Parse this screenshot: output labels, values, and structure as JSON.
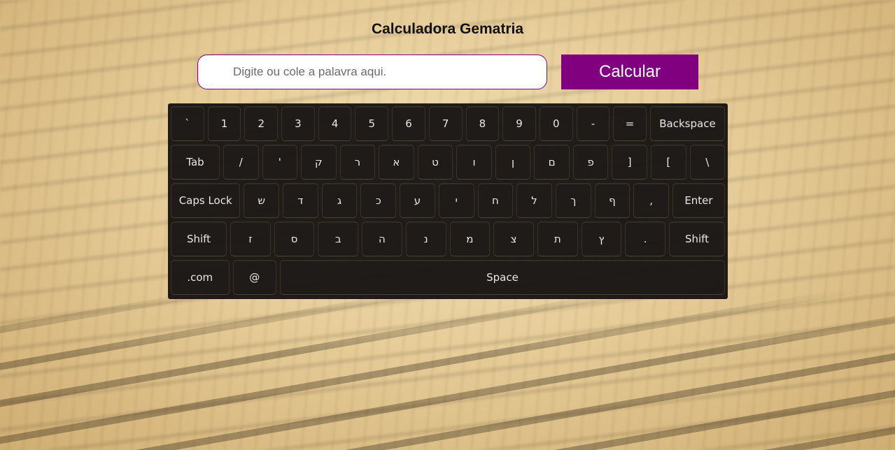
{
  "page": {
    "title": "Calculadora Gematria",
    "search": {
      "value": "",
      "placeholder": "Digite ou cole a palavra aqui."
    },
    "calc_button": "Calcular",
    "colors": {
      "accent": "#800080",
      "keyboard_bg": "#0f0c0a"
    }
  },
  "keyboard": {
    "rows": [
      {
        "keys": [
          {
            "label": "`",
            "grow": 1
          },
          {
            "label": "1",
            "grow": 1
          },
          {
            "label": "2",
            "grow": 1
          },
          {
            "label": "3",
            "grow": 1
          },
          {
            "label": "4",
            "grow": 1
          },
          {
            "label": "5",
            "grow": 1
          },
          {
            "label": "6",
            "grow": 1
          },
          {
            "label": "7",
            "grow": 1
          },
          {
            "label": "8",
            "grow": 1
          },
          {
            "label": "9",
            "grow": 1
          },
          {
            "label": "0",
            "grow": 1
          },
          {
            "label": "-",
            "grow": 1
          },
          {
            "label": "=",
            "grow": 1
          },
          {
            "label": "Backspace",
            "grow": 2.3
          }
        ]
      },
      {
        "keys": [
          {
            "label": "Tab",
            "grow": 1.4
          },
          {
            "label": "/",
            "grow": 1
          },
          {
            "label": "'",
            "grow": 1
          },
          {
            "label": "ק",
            "grow": 1
          },
          {
            "label": "ר",
            "grow": 1
          },
          {
            "label": "א",
            "grow": 1
          },
          {
            "label": "ט",
            "grow": 1
          },
          {
            "label": "ו",
            "grow": 1
          },
          {
            "label": "ן",
            "grow": 1
          },
          {
            "label": "ם",
            "grow": 1
          },
          {
            "label": "פ",
            "grow": 1
          },
          {
            "label": "]",
            "grow": 1
          },
          {
            "label": "[",
            "grow": 1
          },
          {
            "label": "\\",
            "grow": 1
          }
        ]
      },
      {
        "keys": [
          {
            "label": "Caps Lock",
            "grow": 2
          },
          {
            "label": "ש",
            "grow": 1
          },
          {
            "label": "ד",
            "grow": 1
          },
          {
            "label": "ג",
            "grow": 1
          },
          {
            "label": "כ",
            "grow": 1
          },
          {
            "label": "ע",
            "grow": 1
          },
          {
            "label": "י",
            "grow": 1
          },
          {
            "label": "ח",
            "grow": 1
          },
          {
            "label": "ל",
            "grow": 1
          },
          {
            "label": "ך",
            "grow": 1
          },
          {
            "label": "ף",
            "grow": 1
          },
          {
            "label": ",",
            "grow": 1
          },
          {
            "label": "Enter",
            "grow": 1.5
          }
        ]
      },
      {
        "keys": [
          {
            "label": "Shift",
            "grow": 1.4
          },
          {
            "label": "ז",
            "grow": 1
          },
          {
            "label": "ס",
            "grow": 1
          },
          {
            "label": "ב",
            "grow": 1
          },
          {
            "label": "ה",
            "grow": 1
          },
          {
            "label": "נ",
            "grow": 1
          },
          {
            "label": "מ",
            "grow": 1
          },
          {
            "label": "צ",
            "grow": 1
          },
          {
            "label": "ת",
            "grow": 1
          },
          {
            "label": "ץ",
            "grow": 1
          },
          {
            "label": ".",
            "grow": 1
          },
          {
            "label": "Shift",
            "grow": 1.4
          }
        ]
      },
      {
        "keys": [
          {
            "label": ".com",
            "grow": 1.35
          },
          {
            "label": "@",
            "grow": 1
          },
          {
            "label": "Space",
            "grow": 10.5
          }
        ]
      }
    ]
  }
}
